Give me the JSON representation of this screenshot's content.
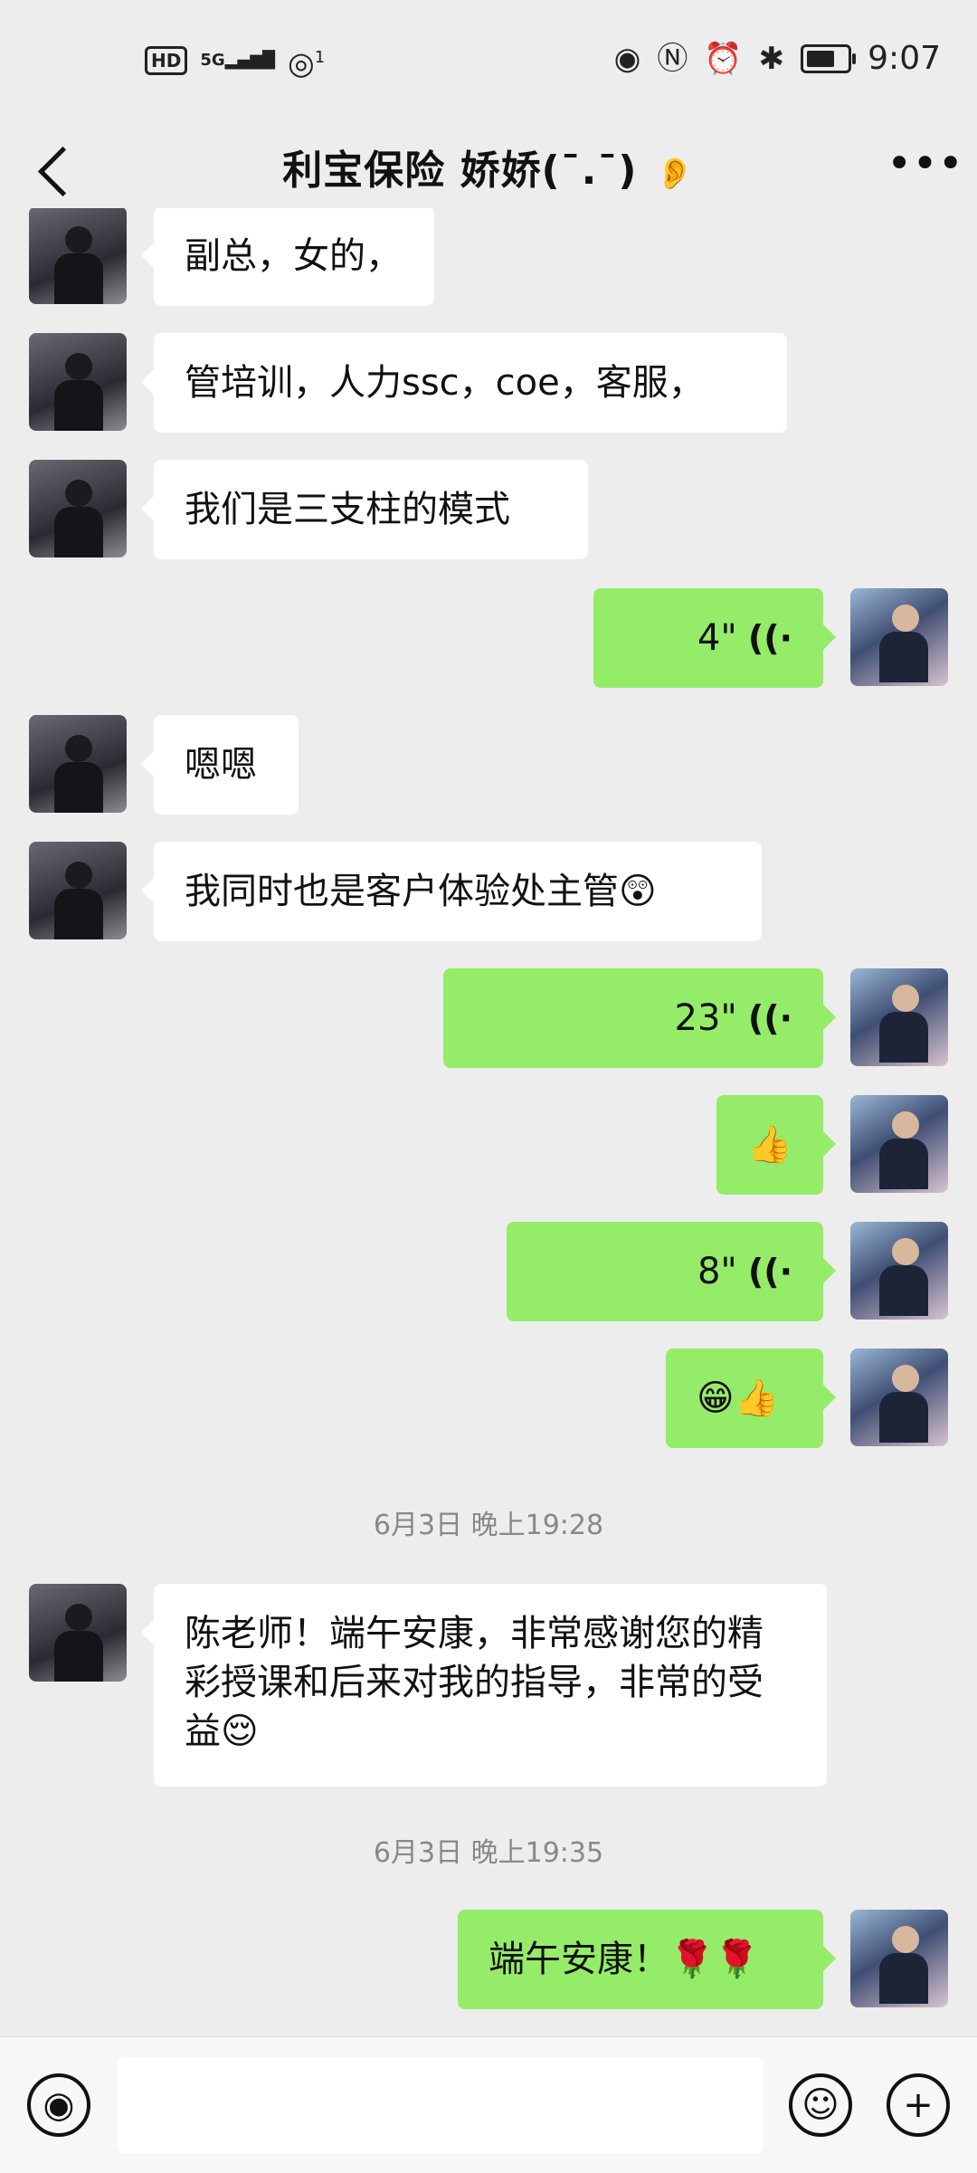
{
  "status_bar": {
    "network_hd": "HD",
    "network_5g": "5G",
    "hotspot_count": "1",
    "time": "9:07",
    "battery_level": 0.75,
    "icons": [
      "hd-icon",
      "signal-icon",
      "wifi-hotspot-icon",
      "eye-icon",
      "nfc-icon",
      "alarm-icon",
      "bluetooth-icon",
      "battery-icon"
    ]
  },
  "nav": {
    "title": "利宝保险  娇娇(¯.¯)",
    "ear_icon": "ear-icon",
    "back_icon": "back-arrow-icon",
    "more_icon": "more-dots-icon"
  },
  "messages": [
    {
      "side": "left",
      "text": "副总，女的，"
    },
    {
      "side": "left",
      "text": "管培训，人力ssc，coe，客服，"
    },
    {
      "side": "left",
      "text": "我们是三支柱的模式"
    },
    {
      "side": "right",
      "type": "voice",
      "duration": "4\""
    },
    {
      "side": "left",
      "text": "嗯嗯"
    },
    {
      "side": "left",
      "text": "我同时也是客户体验处主管😲"
    },
    {
      "side": "right",
      "type": "voice",
      "duration": "23\""
    },
    {
      "side": "right",
      "text": "👍"
    },
    {
      "side": "right",
      "type": "voice",
      "duration": "8\""
    },
    {
      "side": "right",
      "text": "😁👍"
    },
    {
      "type": "timestamp",
      "text": "6月3日 晚上19:28"
    },
    {
      "side": "left",
      "text": "陈老师！端午安康，非常感谢您的精彩授课和后来对我的指导，非常的受益😌"
    },
    {
      "type": "timestamp",
      "text": "6月3日 晚上19:35"
    },
    {
      "side": "right",
      "text": "端午安康！🌹🌹"
    }
  ],
  "input_bar": {
    "voice_icon": "voice-input-icon",
    "emoji_icon": "emoji-icon",
    "plus_icon": "plus-icon",
    "voice_glyph": "◉",
    "emoji_glyph": "☺",
    "plus_glyph": "+"
  },
  "colors": {
    "background": "#ededed",
    "bubble_self": "#95ec69",
    "bubble_other": "#ffffff"
  }
}
